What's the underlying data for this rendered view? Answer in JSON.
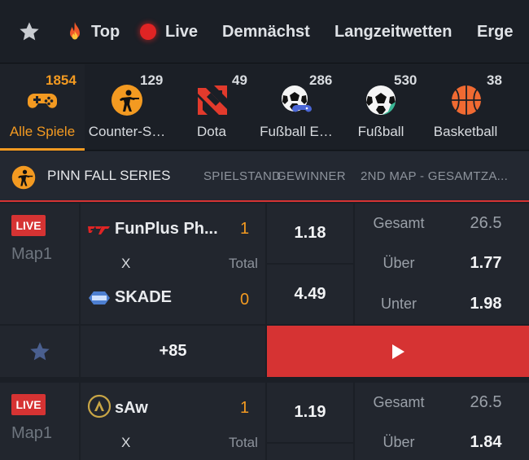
{
  "topnav": {
    "items": [
      {
        "label": ""
      },
      {
        "label": "Top"
      },
      {
        "label": "Live"
      },
      {
        "label": "Demnächst"
      },
      {
        "label": "Langzeitwetten"
      },
      {
        "label": "Erge"
      }
    ]
  },
  "categories": [
    {
      "label": "Alle Spiele",
      "count": "1854",
      "icon": "gamepad-icon",
      "active": true
    },
    {
      "label": "Counter-S…",
      "count": "129",
      "icon": "counter-strike-icon"
    },
    {
      "label": "Dota",
      "count": "49",
      "icon": "dota-icon"
    },
    {
      "label": "Fußball E…",
      "count": "286",
      "icon": "efootball-icon"
    },
    {
      "label": "Fußball",
      "count": "530",
      "icon": "football-icon"
    },
    {
      "label": "Basketball",
      "count": "38",
      "icon": "basketball-icon"
    }
  ],
  "league": {
    "name": "PINN FALL SERIES",
    "col_spielstand": "SPIELSTAND",
    "col_gewinner": "GEWINNER",
    "col_map": "2ND MAP - GESAMTZA..."
  },
  "matches": [
    {
      "live": "LIVE",
      "map": "Map1",
      "team1": "FunPlus Ph...",
      "score1": "1",
      "x": "X",
      "total_label": "Total",
      "team2": "SKADE",
      "score2": "0",
      "odd1": "1.18",
      "odd2": "4.49",
      "gesamt_label": "Gesamt",
      "gesamt_value": "26.5",
      "over_label": "Über",
      "over_value": "1.77",
      "under_label": "Unter",
      "under_value": "1.98",
      "more": "+85"
    },
    {
      "live": "LIVE",
      "map": "Map1",
      "team1": "sAw",
      "score1": "1",
      "x": "X",
      "total_label": "Total",
      "odd1": "1.19",
      "gesamt_label": "Gesamt",
      "gesamt_value": "26.5",
      "over_label": "Über",
      "over_value": "1.84"
    }
  ],
  "colors": {
    "accent": "#f39a21",
    "live": "#d63333",
    "background": "#1b1f26"
  }
}
